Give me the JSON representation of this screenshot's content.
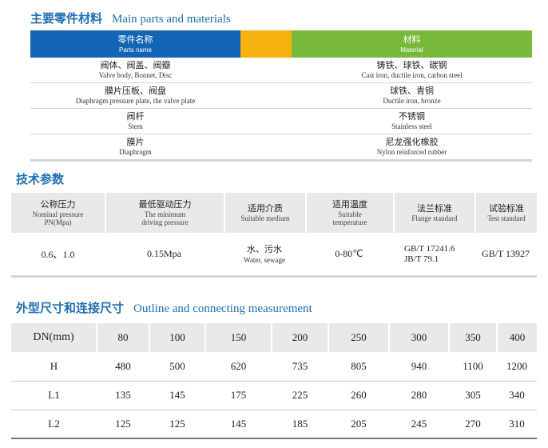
{
  "section1": {
    "title_zh": "主要零件材料",
    "title_en": "Main parts and materials"
  },
  "materials": {
    "header": {
      "part_zh": "零件名称",
      "part_en": "Parts name",
      "material_zh": "材料",
      "material_en": "Material"
    },
    "rows": [
      {
        "part_zh": "阀体、阀盖、阀瓣",
        "part_en": "Valve body, Bonnet, Disc",
        "mat_zh": "铸铁、球铁、碳钢",
        "mat_en": "Cast iron, ductile iron, carbon steel"
      },
      {
        "part_zh": "膜片压板、阀盘",
        "part_en": "Diaphragm pressure plate, the valve plate",
        "mat_zh": "球铁、青铜",
        "mat_en": "Ductile iron, bronze"
      },
      {
        "part_zh": "阀杆",
        "part_en": "Stem",
        "mat_zh": "不锈钢",
        "mat_en": "Stainless steel"
      },
      {
        "part_zh": "膜片",
        "part_en": "Diaphragm",
        "mat_zh": "尼龙强化橡胶",
        "mat_en": "Nylon reinforced rubber"
      }
    ],
    "colors": {
      "header_blue": "#1565b5",
      "header_orange": "#f7b20f",
      "header_green": "#78b83a"
    }
  },
  "section2": {
    "title_zh": "技术参数"
  },
  "tech": {
    "headers": [
      {
        "zh": "公称压力",
        "en": "Nominal pressure",
        "en2": "PN(Mpa)"
      },
      {
        "zh": "最低驱动压力",
        "en": "The minimum",
        "en2": "driving pressure"
      },
      {
        "zh": "适用介质",
        "en": "Suitable medium",
        "en2": ""
      },
      {
        "zh": "适用温度",
        "en": "Suitable",
        "en2": "temperature"
      },
      {
        "zh": "法兰标准",
        "en": "Flange standard",
        "en2": ""
      },
      {
        "zh": "试验标准",
        "en": "Test standard",
        "en2": ""
      }
    ],
    "values": {
      "pressure": "0.6、1.0",
      "min_drive": "0.15Mpa",
      "medium_zh": "水、污水",
      "medium_en": "Water, sewage",
      "temperature": "0-80℃",
      "flange_1": "GB/T 17241.6",
      "flange_2": "JB/T 79.1",
      "test": "GB/T 13927"
    }
  },
  "section3": {
    "title_zh": "外型尺寸和连接尺寸",
    "title_en": "Outline and connecting measurement"
  },
  "dimensions": {
    "header_label": "DN(mm)",
    "dn": [
      "80",
      "100",
      "150",
      "200",
      "250",
      "300",
      "350",
      "400"
    ],
    "rows": [
      {
        "label": "H",
        "values": [
          "480",
          "500",
          "620",
          "735",
          "805",
          "940",
          "1100",
          "1200"
        ]
      },
      {
        "label": "L1",
        "values": [
          "135",
          "145",
          "175",
          "225",
          "260",
          "280",
          "305",
          "340"
        ]
      },
      {
        "label": "L2",
        "values": [
          "125",
          "125",
          "145",
          "185",
          "205",
          "245",
          "270",
          "310"
        ]
      }
    ]
  }
}
